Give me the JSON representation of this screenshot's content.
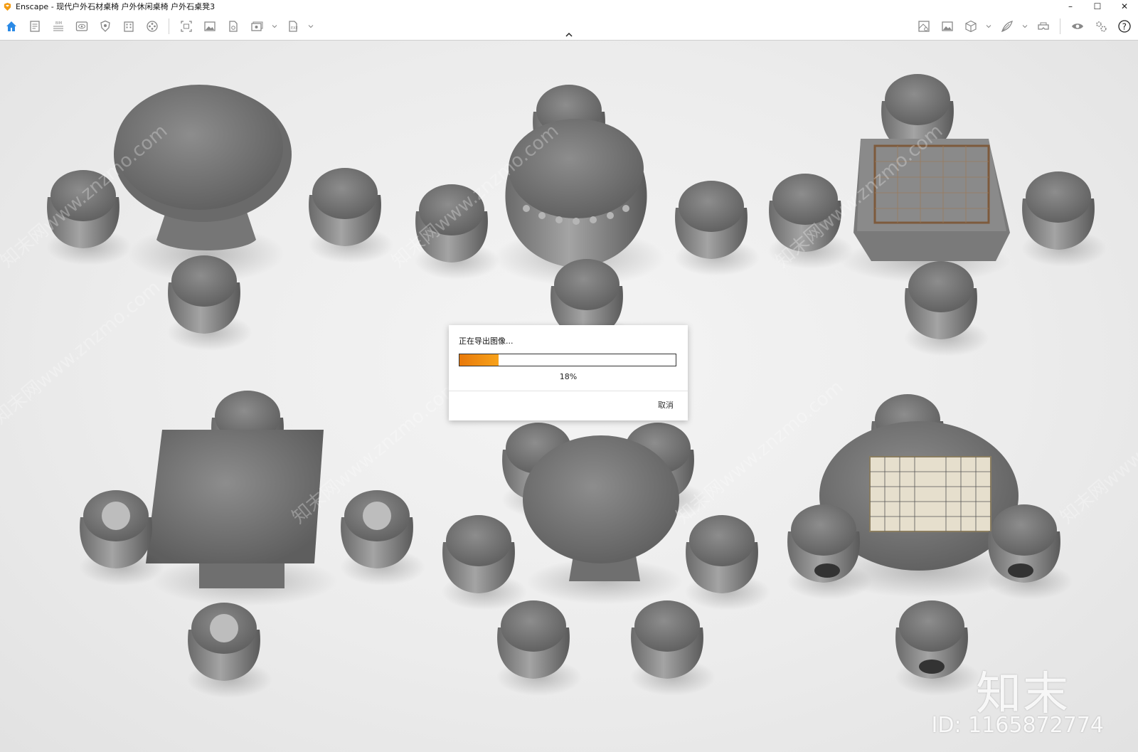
{
  "window": {
    "title": "Enscape - 现代户外石材桌椅 户外休闲桌椅 户外石桌凳3",
    "logo_color": "#f39c12",
    "controls": {
      "minimize": "–",
      "maximize": "☐",
      "close": "✕"
    }
  },
  "toolbar": {
    "accent_color": "#2b8ae6",
    "left_icons": [
      "home-icon",
      "document-icon",
      "bim-icon",
      "eye-panel-icon",
      "shield-icon",
      "building-icon",
      "film-reel-icon",
      "capture-frame-icon",
      "image-icon",
      "file-export-icon",
      "batch-render-icon",
      "export-file-icon"
    ],
    "right_icons": [
      "material-icon",
      "picture-library-icon",
      "cube-icon",
      "leaf-brush-icon",
      "vr-headset-icon",
      "visibility-icon",
      "settings-icon",
      "help-icon"
    ]
  },
  "dialog": {
    "title": "正在导出图像...",
    "progress_percent": 18,
    "progress_text": "18%",
    "cancel_label": "取消",
    "progress_color": "#f08a12"
  },
  "watermark": {
    "brand": "知末",
    "id_text": "ID: 1165872774",
    "tile_text": "知末网www.znzmo.com"
  }
}
